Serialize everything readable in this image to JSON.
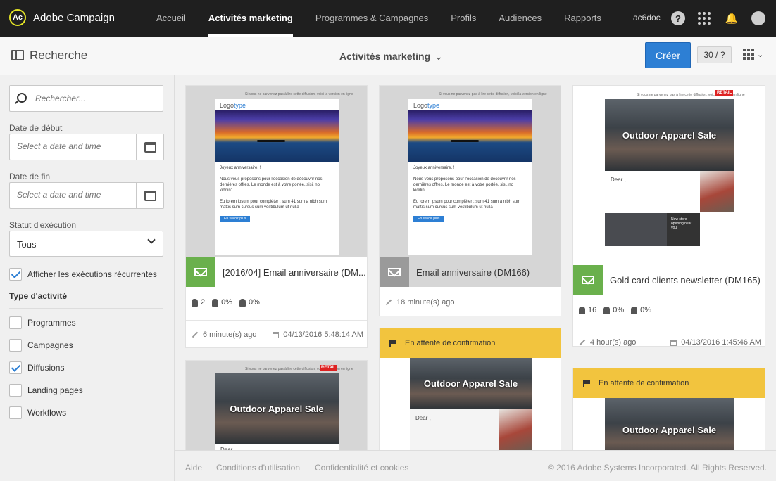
{
  "app": {
    "name": "Adobe Campaign",
    "logo": "Ac"
  },
  "nav": {
    "items": [
      "Accueil",
      "Activités marketing",
      "Programmes & Campagnes",
      "Profils",
      "Audiences",
      "Rapports"
    ],
    "active": "Activités marketing"
  },
  "user": {
    "name": "ac6doc",
    "help": "?"
  },
  "subheader": {
    "search_title": "Recherche",
    "view_title": "Activités marketing",
    "create": "Créer",
    "counter": "30 / ?"
  },
  "filters": {
    "search_placeholder": "Rechercher...",
    "start_label": "Date de début",
    "start_placeholder": "Select a date and time",
    "end_label": "Date de fin",
    "end_placeholder": "Select a date and time",
    "status_label": "Statut d'exécution",
    "status_value": "Tous",
    "recurrent_label": "Afficher les exécutions récurrentes",
    "type_title": "Type d'activité",
    "types": [
      {
        "label": "Programmes",
        "checked": false
      },
      {
        "label": "Campagnes",
        "checked": false
      },
      {
        "label": "Diffusions",
        "checked": true
      },
      {
        "label": "Landing pages",
        "checked": false
      },
      {
        "label": "Workflows",
        "checked": false
      }
    ]
  },
  "cards": [
    {
      "title": "[2016/04] Email anniversaire (DM...",
      "stat_users": "2",
      "stat_open": "0%",
      "stat_click": "0%",
      "modified": "6 minute(s) ago",
      "date": "04/13/2016 5:48:14 AM"
    },
    {
      "title": "Email anniversaire (DM166)",
      "modified": "18 minute(s) ago"
    },
    {
      "title": "Gold card clients newsletter (DM165)",
      "stat_users": "16",
      "stat_open": "0%",
      "stat_click": "0%",
      "modified": "4 hour(s) ago",
      "date": "04/13/2016 1:45:46 AM"
    },
    {
      "pending": "En attente de confirmation"
    },
    {
      "pending": "En attente de confirmation"
    }
  ],
  "email_preview": {
    "top_note": "Si vous ne parvenez pas à lire cette diffusion, voici la version en ligne",
    "logo_a": "Logo",
    "logo_b": "type",
    "greeting": "Joyeux anniversaire, !",
    "body": "Nous vous proposons pour l'occasion de découvrir nos dernières offres. Le monde est à votre portée, sisi, no kiddin'.",
    "list": "Eu lorem ipsum pour compléter : sum 41 sum a nibh sum mattis sum cursus sum vestibulum ut nulla",
    "button": "En savoir plus",
    "sale": "Outdoor Apparel Sale",
    "dear": "Dear ,",
    "retail": "RETAIL",
    "new_store": "New store opening near you!"
  },
  "footer": {
    "help": "Aide",
    "terms": "Conditions d'utilisation",
    "privacy": "Confidentialité et cookies",
    "copyright": "© 2016 Adobe Systems Incorporated. All Rights Reserved."
  }
}
